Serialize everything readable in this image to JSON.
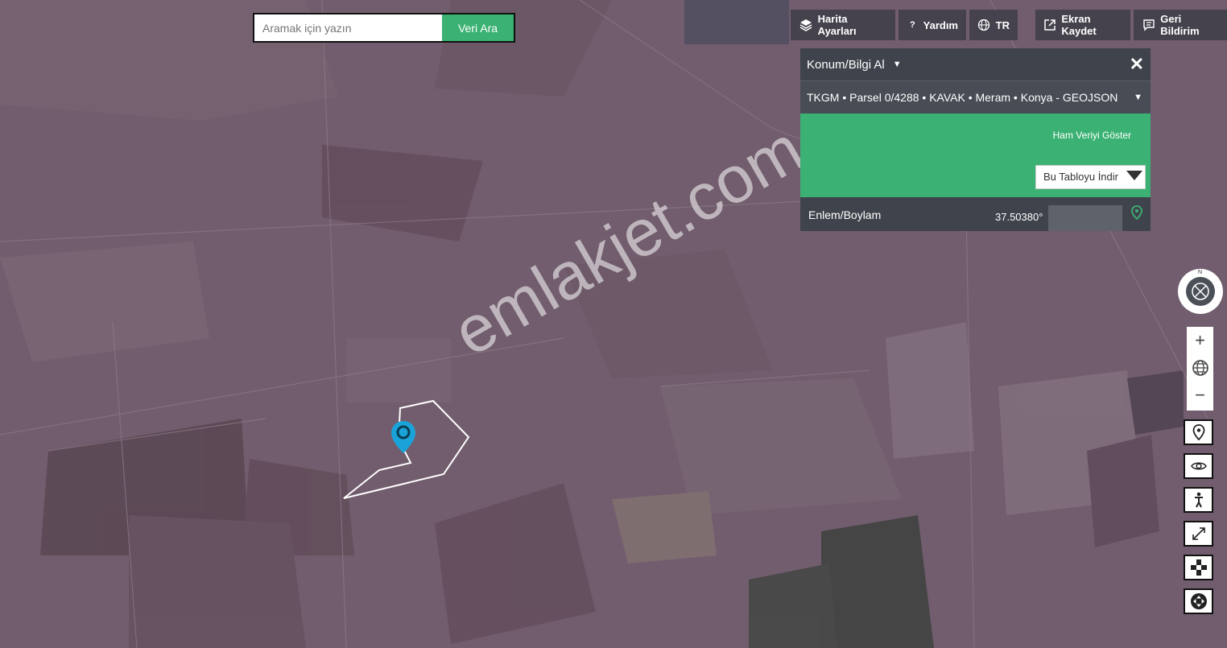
{
  "search": {
    "placeholder": "Aramak için yazın",
    "button_label": "Veri Ara"
  },
  "toolbar": {
    "map_settings": "Harita Ayarları",
    "help": "Yardım",
    "language": "TR",
    "save_screen": "Ekran Kaydet",
    "feedback": "Geri Bildirim"
  },
  "panel": {
    "title": "Konum/Bilgi Al",
    "source": "TKGM • Parsel 0/4288 • KAVAK • Meram • Konya - GEOJSON",
    "raw_button": "Ham Veriyi Göster",
    "download_select": "Bu Tabloyu İndir",
    "coord_label": "Enlem/Boylam",
    "coord_value": "37.50380°"
  },
  "watermark": "emlakjet.com",
  "compass_letter": "N",
  "colors": {
    "accent": "#3bb273",
    "panel": "#3f434c",
    "marker": "#1aa3d9"
  }
}
